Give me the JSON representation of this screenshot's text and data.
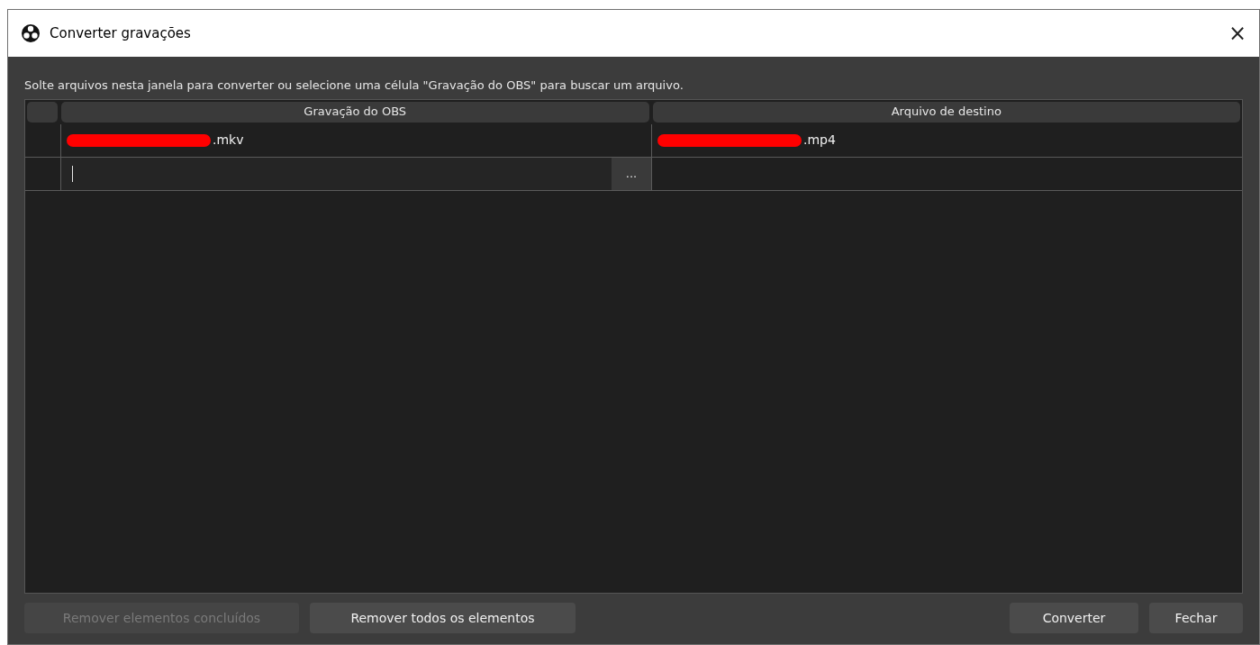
{
  "window": {
    "title": "Converter gravações",
    "close": "×"
  },
  "hint": "Solte arquivos nesta janela para converter ou selecione uma célula \"Gravação do OBS\" para buscar um arquivo.",
  "table": {
    "columns": [
      "Gravação do OBS",
      "Arquivo de destino"
    ],
    "rows": [
      {
        "kind": "file",
        "source": ".mkv",
        "target": ".mp4"
      },
      {
        "kind": "edit",
        "browse": "..."
      }
    ]
  },
  "buttons_left": [
    {
      "label": "Remover elementos concluídos",
      "disabled": true
    },
    {
      "label": "Remover todos os elementos",
      "disabled": false
    }
  ],
  "buttons_right": [
    {
      "label": "Converter",
      "disabled": false
    },
    {
      "label": "Fechar",
      "disabled": false
    }
  ]
}
